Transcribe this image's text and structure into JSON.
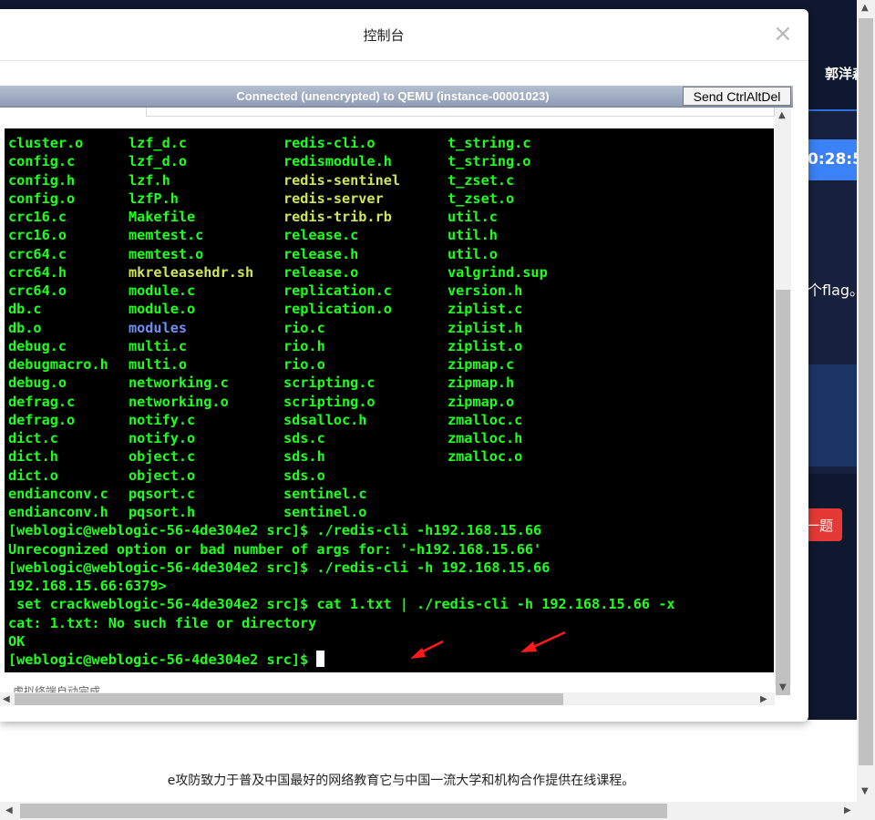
{
  "background": {
    "user_name": "郭洋森",
    "timer": "0:28:5",
    "flag_text": "个flag。",
    "next_button": "一题",
    "footer_text": "e攻防致力于普及中国最好的网络教育它与中国一流大学和机构合作提供在线课程。"
  },
  "modal": {
    "title": "控制台",
    "close_label": "×"
  },
  "novnc": {
    "status": "Connected (unencrypted) to QEMU (instance-00001023)",
    "ctrlaltdel_label": "Send CtrlAltDel"
  },
  "terminal": {
    "file_rows": [
      [
        "cluster.o",
        "lzf_d.c",
        "redis-cli.o",
        "t_string.c"
      ],
      [
        "config.c",
        "lzf_d.o",
        "redismodule.h",
        "t_string.o"
      ],
      [
        "config.h",
        "lzf.h",
        "redis-sentinel",
        "t_zset.c"
      ],
      [
        "config.o",
        "lzfP.h",
        "redis-server",
        "t_zset.o"
      ],
      [
        "crc16.c",
        "Makefile",
        "redis-trib.rb",
        "util.c"
      ],
      [
        "crc16.o",
        "memtest.c",
        "release.c",
        "util.h"
      ],
      [
        "crc64.c",
        "memtest.o",
        "release.h",
        "util.o"
      ],
      [
        "crc64.h",
        "mkreleasehdr.sh",
        "release.o",
        "valgrind.sup"
      ],
      [
        "crc64.o",
        "module.c",
        "replication.c",
        "version.h"
      ],
      [
        "db.c",
        "module.o",
        "replication.o",
        "ziplist.c"
      ],
      [
        "db.o",
        "modules",
        "rio.c",
        "ziplist.h"
      ],
      [
        "debug.c",
        "multi.c",
        "rio.h",
        "ziplist.o"
      ],
      [
        "debugmacro.h",
        "multi.o",
        "rio.o",
        "zipmap.c"
      ],
      [
        "debug.o",
        "networking.c",
        "scripting.c",
        "zipmap.h"
      ],
      [
        "defrag.c",
        "networking.o",
        "scripting.o",
        "zipmap.o"
      ],
      [
        "defrag.o",
        "notify.c",
        "sdsalloc.h",
        "zmalloc.c"
      ],
      [
        "dict.c",
        "notify.o",
        "sds.c",
        "zmalloc.h"
      ],
      [
        "dict.h",
        "object.c",
        "sds.h",
        "zmalloc.o"
      ],
      [
        "dict.o",
        "object.o",
        "sds.o",
        ""
      ],
      [
        "endianconv.c",
        "pqsort.c",
        "sentinel.c",
        ""
      ],
      [
        "endianconv.h",
        "pqsort.h",
        "sentinel.o",
        ""
      ]
    ],
    "command_lines": [
      "[weblogic@weblogic-56-4de304e2 src]$ ./redis-cli -h192.168.15.66",
      "Unrecognized option or bad number of args for: '-h192.168.15.66'",
      "[weblogic@weblogic-56-4de304e2 src]$ ./redis-cli -h 192.168.15.66",
      "192.168.15.66:6379>",
      " set crackweblogic-56-4de304e2 src]$ cat 1.txt | ./redis-cli -h 192.168.15.66 -x",
      "cat: 1.txt: No such file or directory",
      "OK"
    ],
    "prompt": "[weblogic@weblogic-56-4de304e2 src]$ ",
    "arrow_color": "#ff1a1a"
  },
  "frame": {
    "bottom_text": "虚拟终端自动完成"
  }
}
